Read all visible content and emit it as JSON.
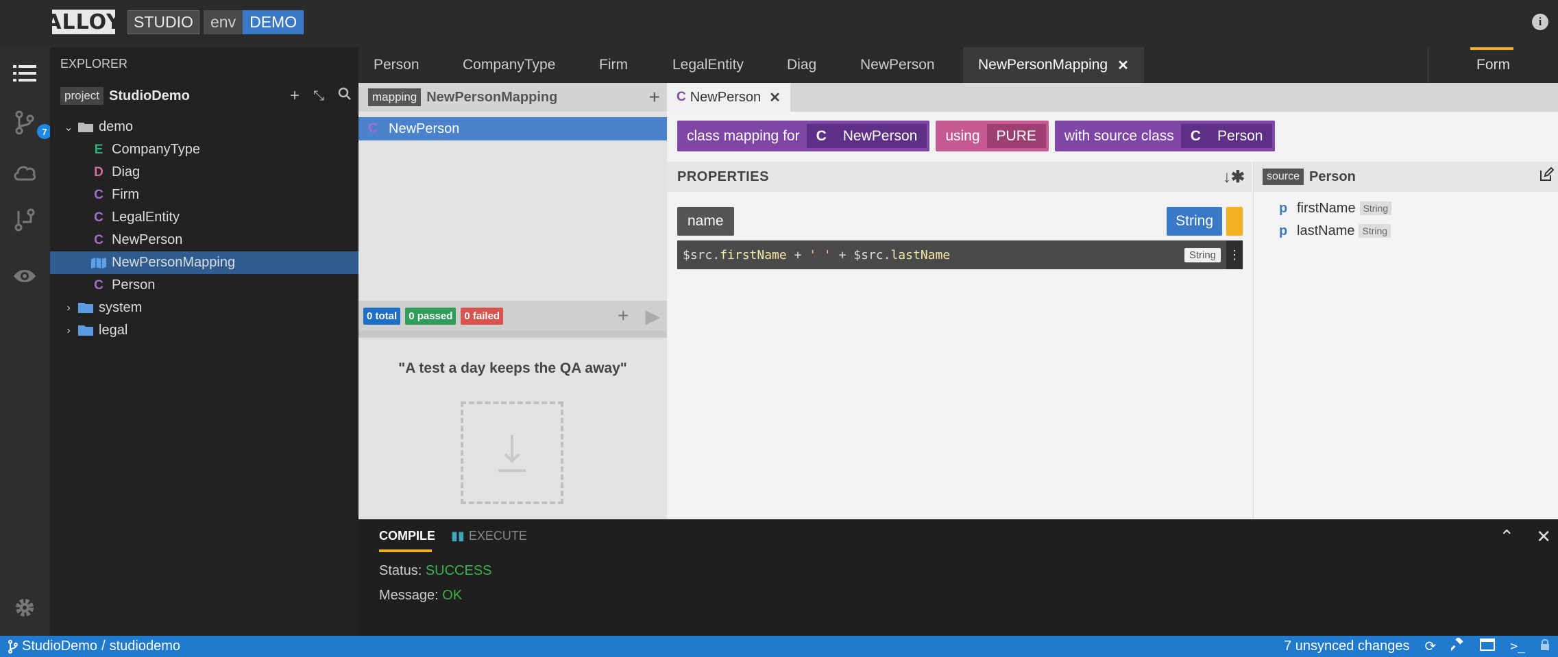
{
  "header": {
    "logo": "ALLOY",
    "studio": "STUDIO",
    "env_label": "env",
    "env_value": "DEMO"
  },
  "activity": {
    "badge_count": "7"
  },
  "explorer": {
    "title": "EXPLORER",
    "project_badge": "project",
    "project_name": "StudioDemo",
    "tree": [
      {
        "label": "demo",
        "kind": "",
        "type": "folder-open"
      },
      {
        "label": "CompanyType",
        "kind": "E",
        "type": "enum"
      },
      {
        "label": "Diag",
        "kind": "D",
        "type": "diagram"
      },
      {
        "label": "Firm",
        "kind": "C",
        "type": "class"
      },
      {
        "label": "LegalEntity",
        "kind": "C",
        "type": "class"
      },
      {
        "label": "NewPerson",
        "kind": "C",
        "type": "class"
      },
      {
        "label": "NewPersonMapping",
        "kind": "M",
        "type": "mapping"
      },
      {
        "label": "Person",
        "kind": "C",
        "type": "class"
      },
      {
        "label": "system",
        "kind": "",
        "type": "folder"
      },
      {
        "label": "legal",
        "kind": "",
        "type": "folder"
      }
    ]
  },
  "tabs": [
    {
      "label": "Person"
    },
    {
      "label": "CompanyType"
    },
    {
      "label": "Firm"
    },
    {
      "label": "LegalEntity"
    },
    {
      "label": "Diag"
    },
    {
      "label": "NewPerson"
    },
    {
      "label": "NewPersonMapping"
    }
  ],
  "form_tab": "Form",
  "mapping_explorer": {
    "badge": "mapping",
    "name": "NewPersonMapping",
    "item_kind": "C",
    "item": "NewPerson",
    "tests": {
      "total": "0 total",
      "passed": "0 passed",
      "failed": "0 failed"
    },
    "quote": "\"A test a day keeps the QA away\""
  },
  "editor": {
    "tab_kind": "C",
    "tab_label": "NewPerson",
    "headline": {
      "class_mapping_for": "class mapping  for",
      "target_kind": "C",
      "target": "NewPerson",
      "using": "using",
      "using_value": "PURE",
      "with_source": "with source class",
      "source_kind": "C",
      "source": "Person"
    },
    "properties_title": "PROPERTIES",
    "property": {
      "name": "name",
      "type": "String",
      "expression_type": "String"
    },
    "source_panel": {
      "badge": "source",
      "name": "Person",
      "properties": [
        {
          "kind": "p",
          "name": "firstName",
          "type": "String"
        },
        {
          "kind": "p",
          "name": "lastName",
          "type": "String"
        }
      ]
    }
  },
  "bottom": {
    "compile_tab": "COMPILE",
    "execute_tab": "EXECUTE",
    "status_label": "Status:",
    "status_value": "SUCCESS",
    "message_label": "Message:",
    "message_value": "OK"
  },
  "statusbar": {
    "project": "StudioDemo",
    "separator": "/",
    "workspace": "studiodemo",
    "changes": "7 unsynced changes"
  },
  "colors": {
    "accent": "#f2b01e",
    "primary_blue": "#3a78c8",
    "status_blue": "#1f7ad0",
    "class_purple": "#7f46a8",
    "pure_pink": "#c65b93"
  }
}
